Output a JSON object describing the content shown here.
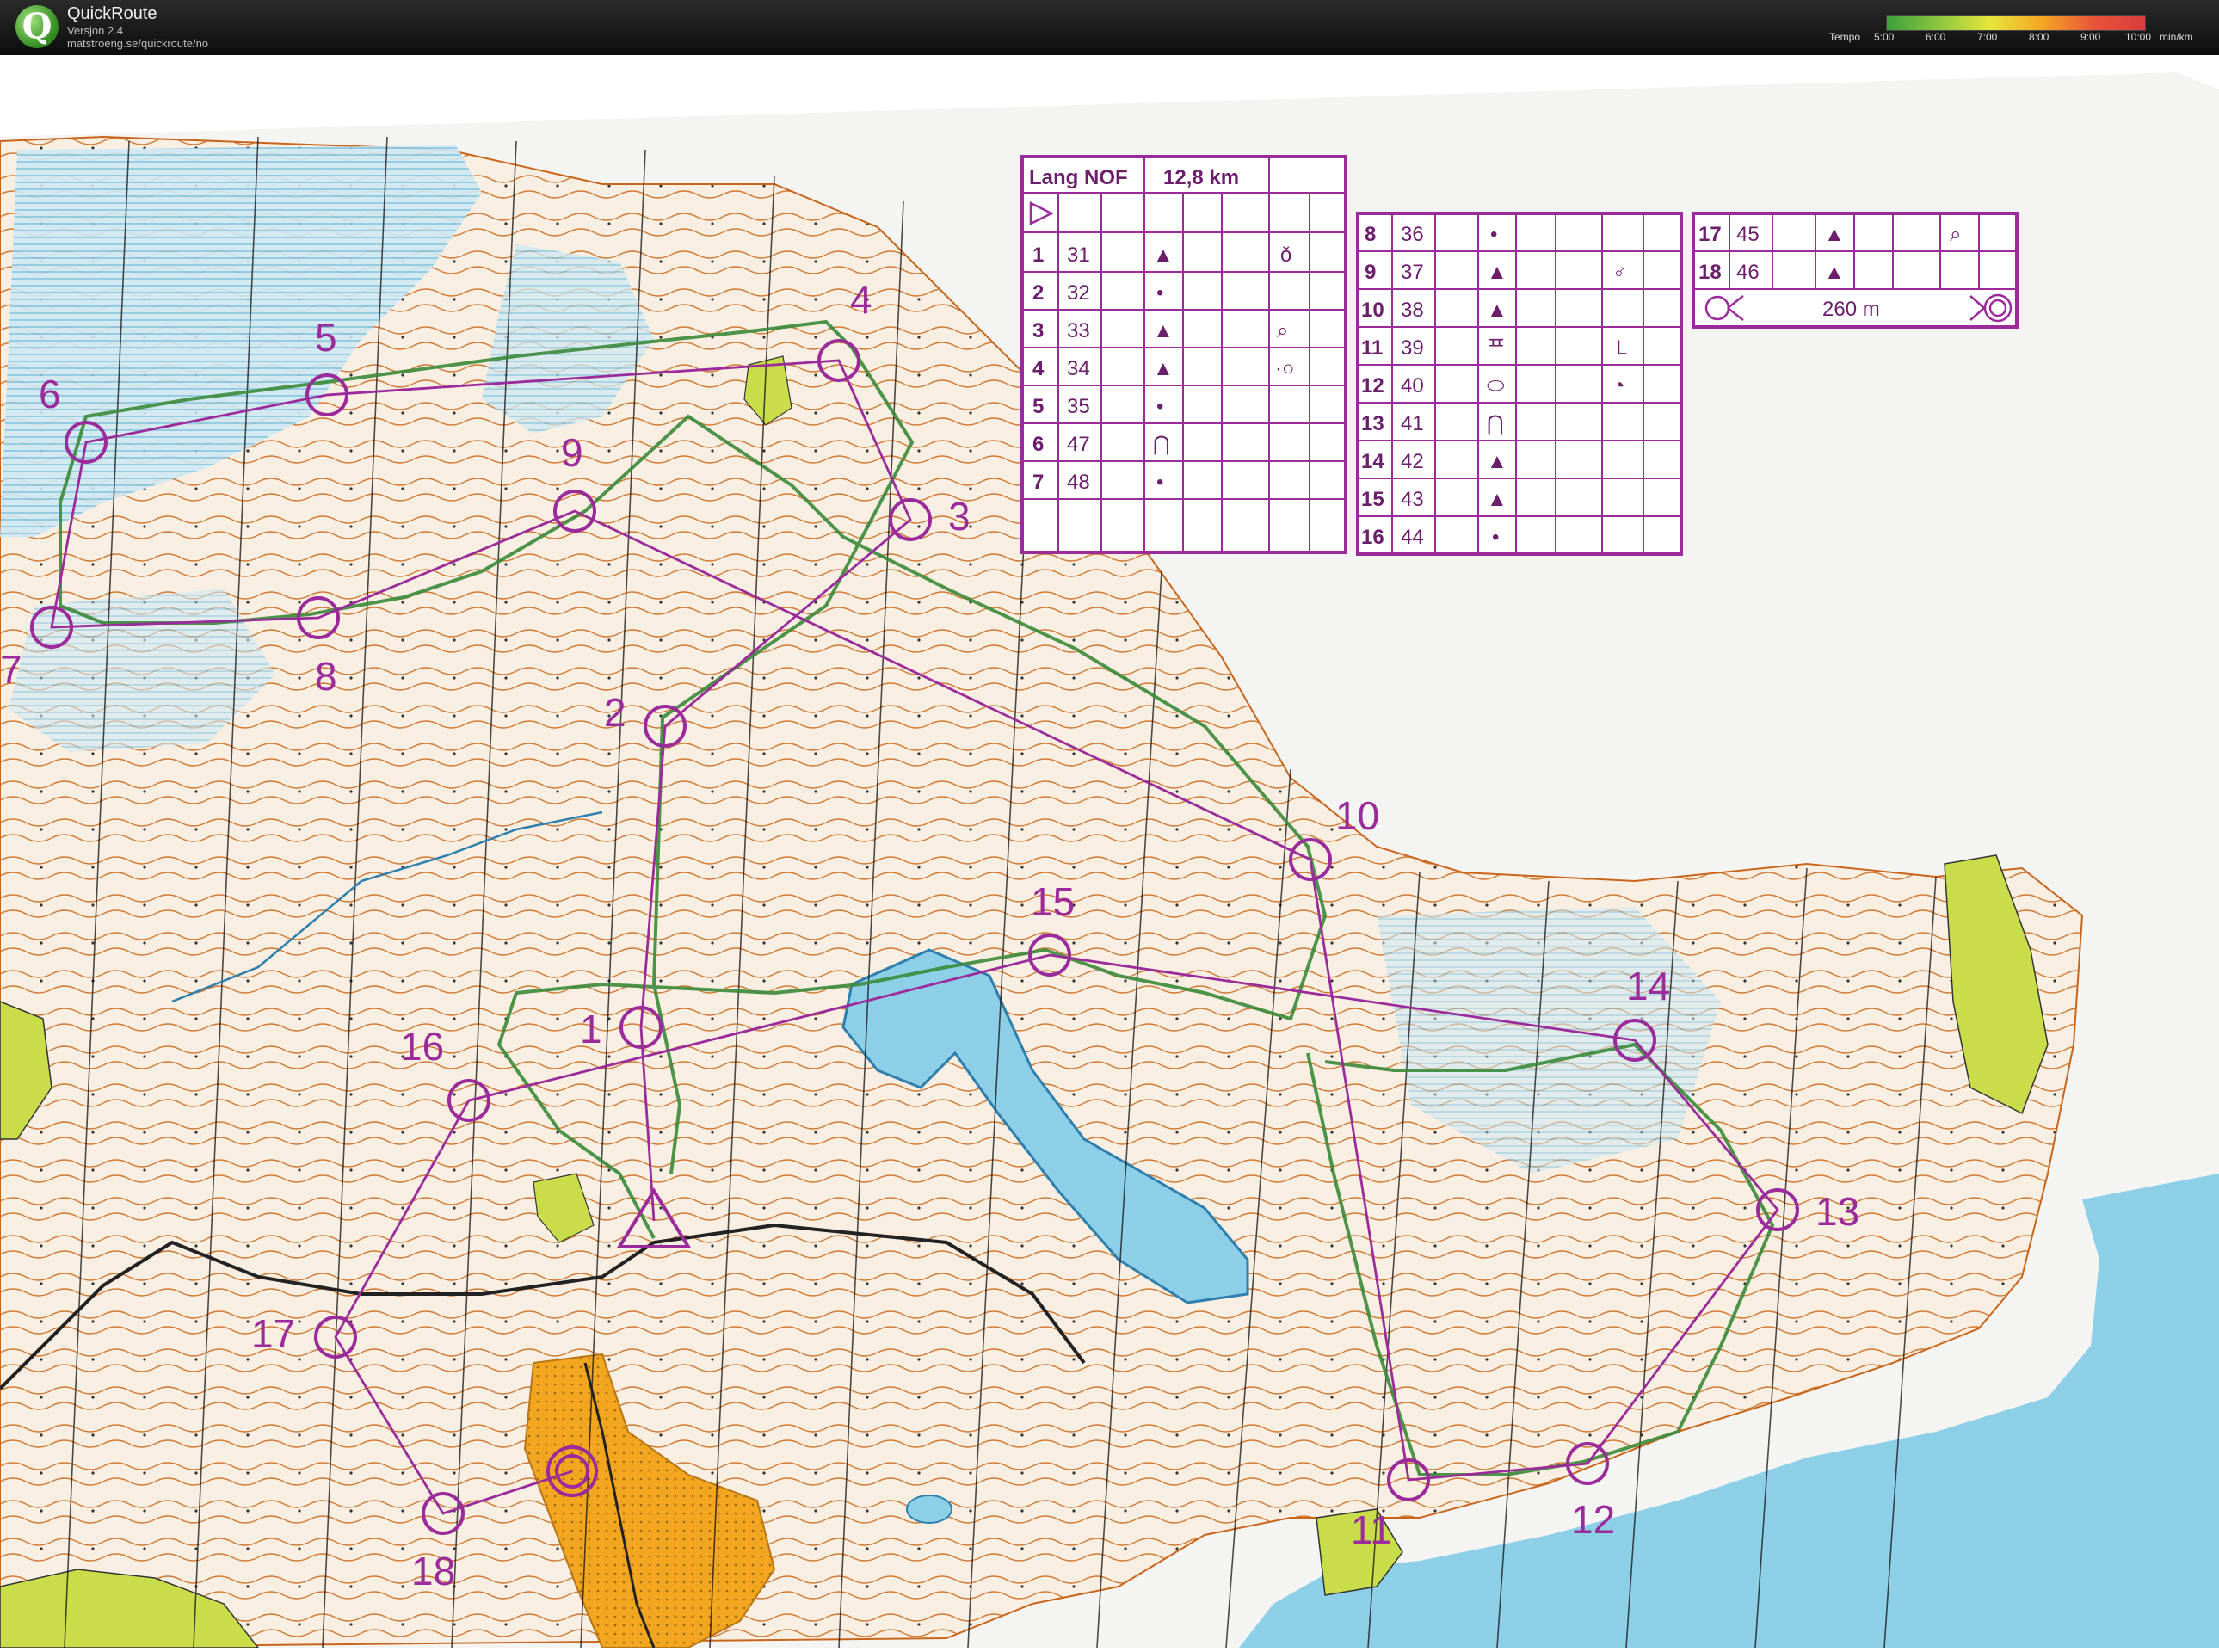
{
  "app": {
    "title": "QuickRoute",
    "version": "Versjon 2.4",
    "url": "matstroeng.se/quickroute/no",
    "logo_letter": "Q"
  },
  "tempo": {
    "label": "Tempo",
    "ticks": [
      "5:00",
      "6:00",
      "7:00",
      "8:00",
      "9:00",
      "10:00"
    ],
    "unit": "min/km"
  },
  "colors": {
    "course": "#9b2a9b",
    "route": "#3a8a3a",
    "water": "#8ecfe8",
    "terrain": "#f7eddd",
    "contour": "#c9651a",
    "settlement": "#c9dd4a",
    "field": "#f2a51f"
  },
  "control_table": {
    "title": "Lang NOF",
    "distance": "12,8 km",
    "controls": [
      {
        "n": "1",
        "code": "31",
        "symbol": "▲",
        "extra": "ǒ"
      },
      {
        "n": "2",
        "code": "32",
        "symbol": "•",
        "extra": ""
      },
      {
        "n": "3",
        "code": "33",
        "symbol": "▲",
        "extra": "⌕"
      },
      {
        "n": "4",
        "code": "34",
        "symbol": "▲",
        "extra": "·○"
      },
      {
        "n": "5",
        "code": "35",
        "symbol": "•",
        "extra": ""
      },
      {
        "n": "6",
        "code": "47",
        "symbol": "⋂",
        "extra": ""
      },
      {
        "n": "7",
        "code": "48",
        "symbol": "•",
        "extra": ""
      },
      {
        "n": "8",
        "code": "36",
        "symbol": "•",
        "extra": ""
      },
      {
        "n": "9",
        "code": "37",
        "symbol": "▲",
        "extra": "♂"
      },
      {
        "n": "10",
        "code": "38",
        "symbol": "▲",
        "extra": ""
      },
      {
        "n": "11",
        "code": "39",
        "symbol": "ᄑ",
        "extra": "L"
      },
      {
        "n": "12",
        "code": "40",
        "symbol": "⬭",
        "extra": "◔"
      },
      {
        "n": "13",
        "code": "41",
        "symbol": "⋂",
        "extra": ""
      },
      {
        "n": "14",
        "code": "42",
        "symbol": "▲",
        "extra": ""
      },
      {
        "n": "15",
        "code": "43",
        "symbol": "▲",
        "extra": ""
      },
      {
        "n": "16",
        "code": "44",
        "symbol": "•",
        "extra": ""
      },
      {
        "n": "17",
        "code": "45",
        "symbol": "▲",
        "extra": "⌕"
      },
      {
        "n": "18",
        "code": "46",
        "symbol": "▲",
        "extra": ""
      }
    ],
    "finish_distance": "260 m"
  },
  "course_labels": [
    "1",
    "2",
    "3",
    "4",
    "5",
    "6",
    "7",
    "8",
    "9",
    "10",
    "11",
    "12",
    "13",
    "14",
    "15",
    "16",
    "17",
    "18"
  ]
}
